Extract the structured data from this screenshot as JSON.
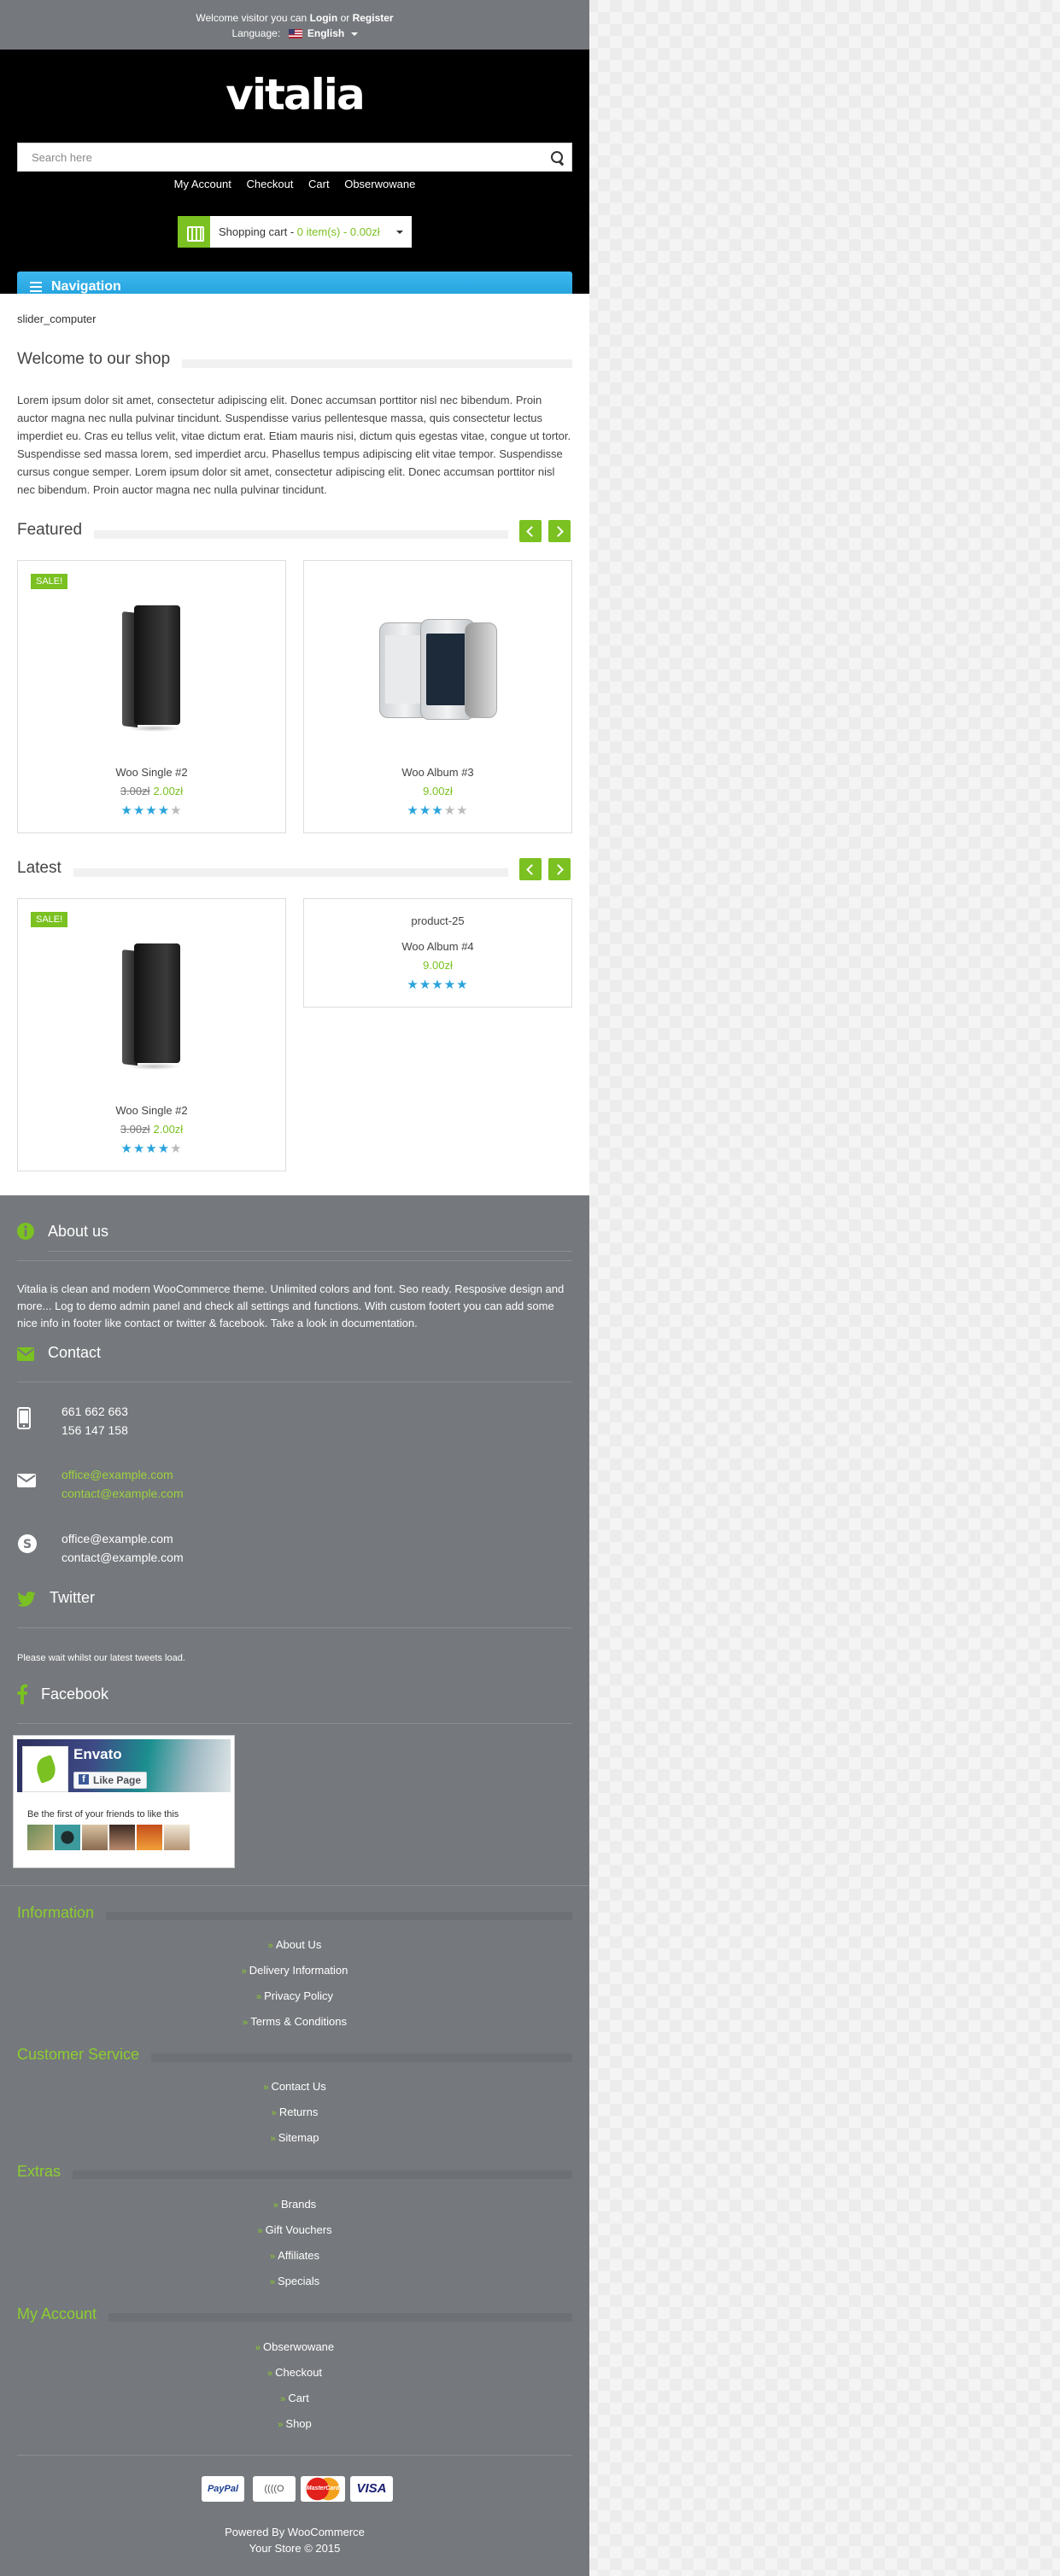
{
  "topbar": {
    "welcome_prefix": "Welcome visitor you can",
    "login": "Login",
    "or": "or",
    "register": "Register",
    "language_label": "Language:",
    "language_value": "English"
  },
  "header": {
    "logo": "vitalia",
    "search_placeholder": "Search here",
    "nav": [
      "My Account",
      "Checkout",
      "Cart",
      "Obserwowane"
    ],
    "cart_label": "Shopping cart -",
    "cart_value": "0 item(s) - 0.00zł"
  },
  "navigation": {
    "label": "Navigation"
  },
  "slider": {
    "label": "slider_computer"
  },
  "welcome": {
    "title": "Welcome to our shop",
    "text": "Lorem ipsum dolor sit amet, consectetur adipiscing elit. Donec accumsan porttitor nisl nec bibendum. Proin auctor magna nec nulla pulvinar tincidunt. Suspendisse varius pellentesque massa, quis consectetur lectus imperdiet eu. Cras eu tellus velit, vitae dictum erat. Etiam mauris nisi, dictum quis egestas vitae, congue ut tortor. Suspendisse sed massa lorem, sed imperdiet arcu. Phasellus tempus adipiscing elit vitae tempor. Suspendisse cursus congue semper. Lorem ipsum dolor sit amet, consectetur adipiscing elit. Donec accumsan porttitor nisl nec bibendum. Proin auctor magna nec nulla pulvinar tincidunt."
  },
  "featured": {
    "title": "Featured",
    "products": [
      {
        "name": "Woo Single #2",
        "sale": "SALE!",
        "old_price": "3.00zł",
        "price": "2.00zł",
        "rating": 4
      },
      {
        "name": "Woo Album #3",
        "price": "9.00zł",
        "rating": 3
      }
    ]
  },
  "latest": {
    "title": "Latest",
    "products": [
      {
        "name": "Woo Single #2",
        "sale": "SALE!",
        "old_price": "3.00zł",
        "price": "2.00zł",
        "rating": 4
      },
      {
        "image_alt": "product-25",
        "name": "Woo Album #4",
        "price": "9.00zł",
        "rating": 5
      }
    ]
  },
  "about": {
    "title": "About us",
    "text": "Vitalia is clean and modern WooCommerce theme. Unlimited colors and font. Seo ready. Resposive design and more... Log to demo admin panel and check all settings and functions. With custom footert you can add some nice info in footer like contact or twitter & facebook. Take a look in documentation."
  },
  "contact": {
    "title": "Contact",
    "phones": [
      "661 662 663",
      "156 147 158"
    ],
    "emails": [
      "office@example.com",
      "contact@example.com"
    ],
    "skype": [
      "office@example.com",
      "contact@example.com"
    ]
  },
  "twitter": {
    "title": "Twitter",
    "text": "Please wait whilst our latest tweets load."
  },
  "facebook": {
    "title": "Facebook",
    "page_name": "Envato",
    "like_label": "Like Page",
    "friends_text": "Be the first of your friends to like this"
  },
  "footer_links": {
    "information": {
      "title": "Information",
      "items": [
        "About Us",
        "Delivery Information",
        "Privacy Policy",
        "Terms & Conditions"
      ]
    },
    "customer_service": {
      "title": "Customer Service",
      "items": [
        "Contact Us",
        "Returns",
        "Sitemap"
      ]
    },
    "extras": {
      "title": "Extras",
      "items": [
        "Brands",
        "Gift Vouchers",
        "Affiliates",
        "Specials"
      ]
    },
    "my_account": {
      "title": "My Account",
      "items": [
        "Obserwowane",
        "Checkout",
        "Cart",
        "Shop"
      ]
    }
  },
  "payments": [
    "PayPal",
    "((((O",
    "MasterCard",
    "VISA"
  ],
  "bottom": {
    "powered": "Powered By WooCommerce",
    "copyright": "Your Store © 2015"
  },
  "colors": {
    "accent_green": "#7ac121",
    "nav_blue": "#1c9ed9",
    "footer_gray": "#75787c",
    "star_blue": "#2aa3dc"
  }
}
